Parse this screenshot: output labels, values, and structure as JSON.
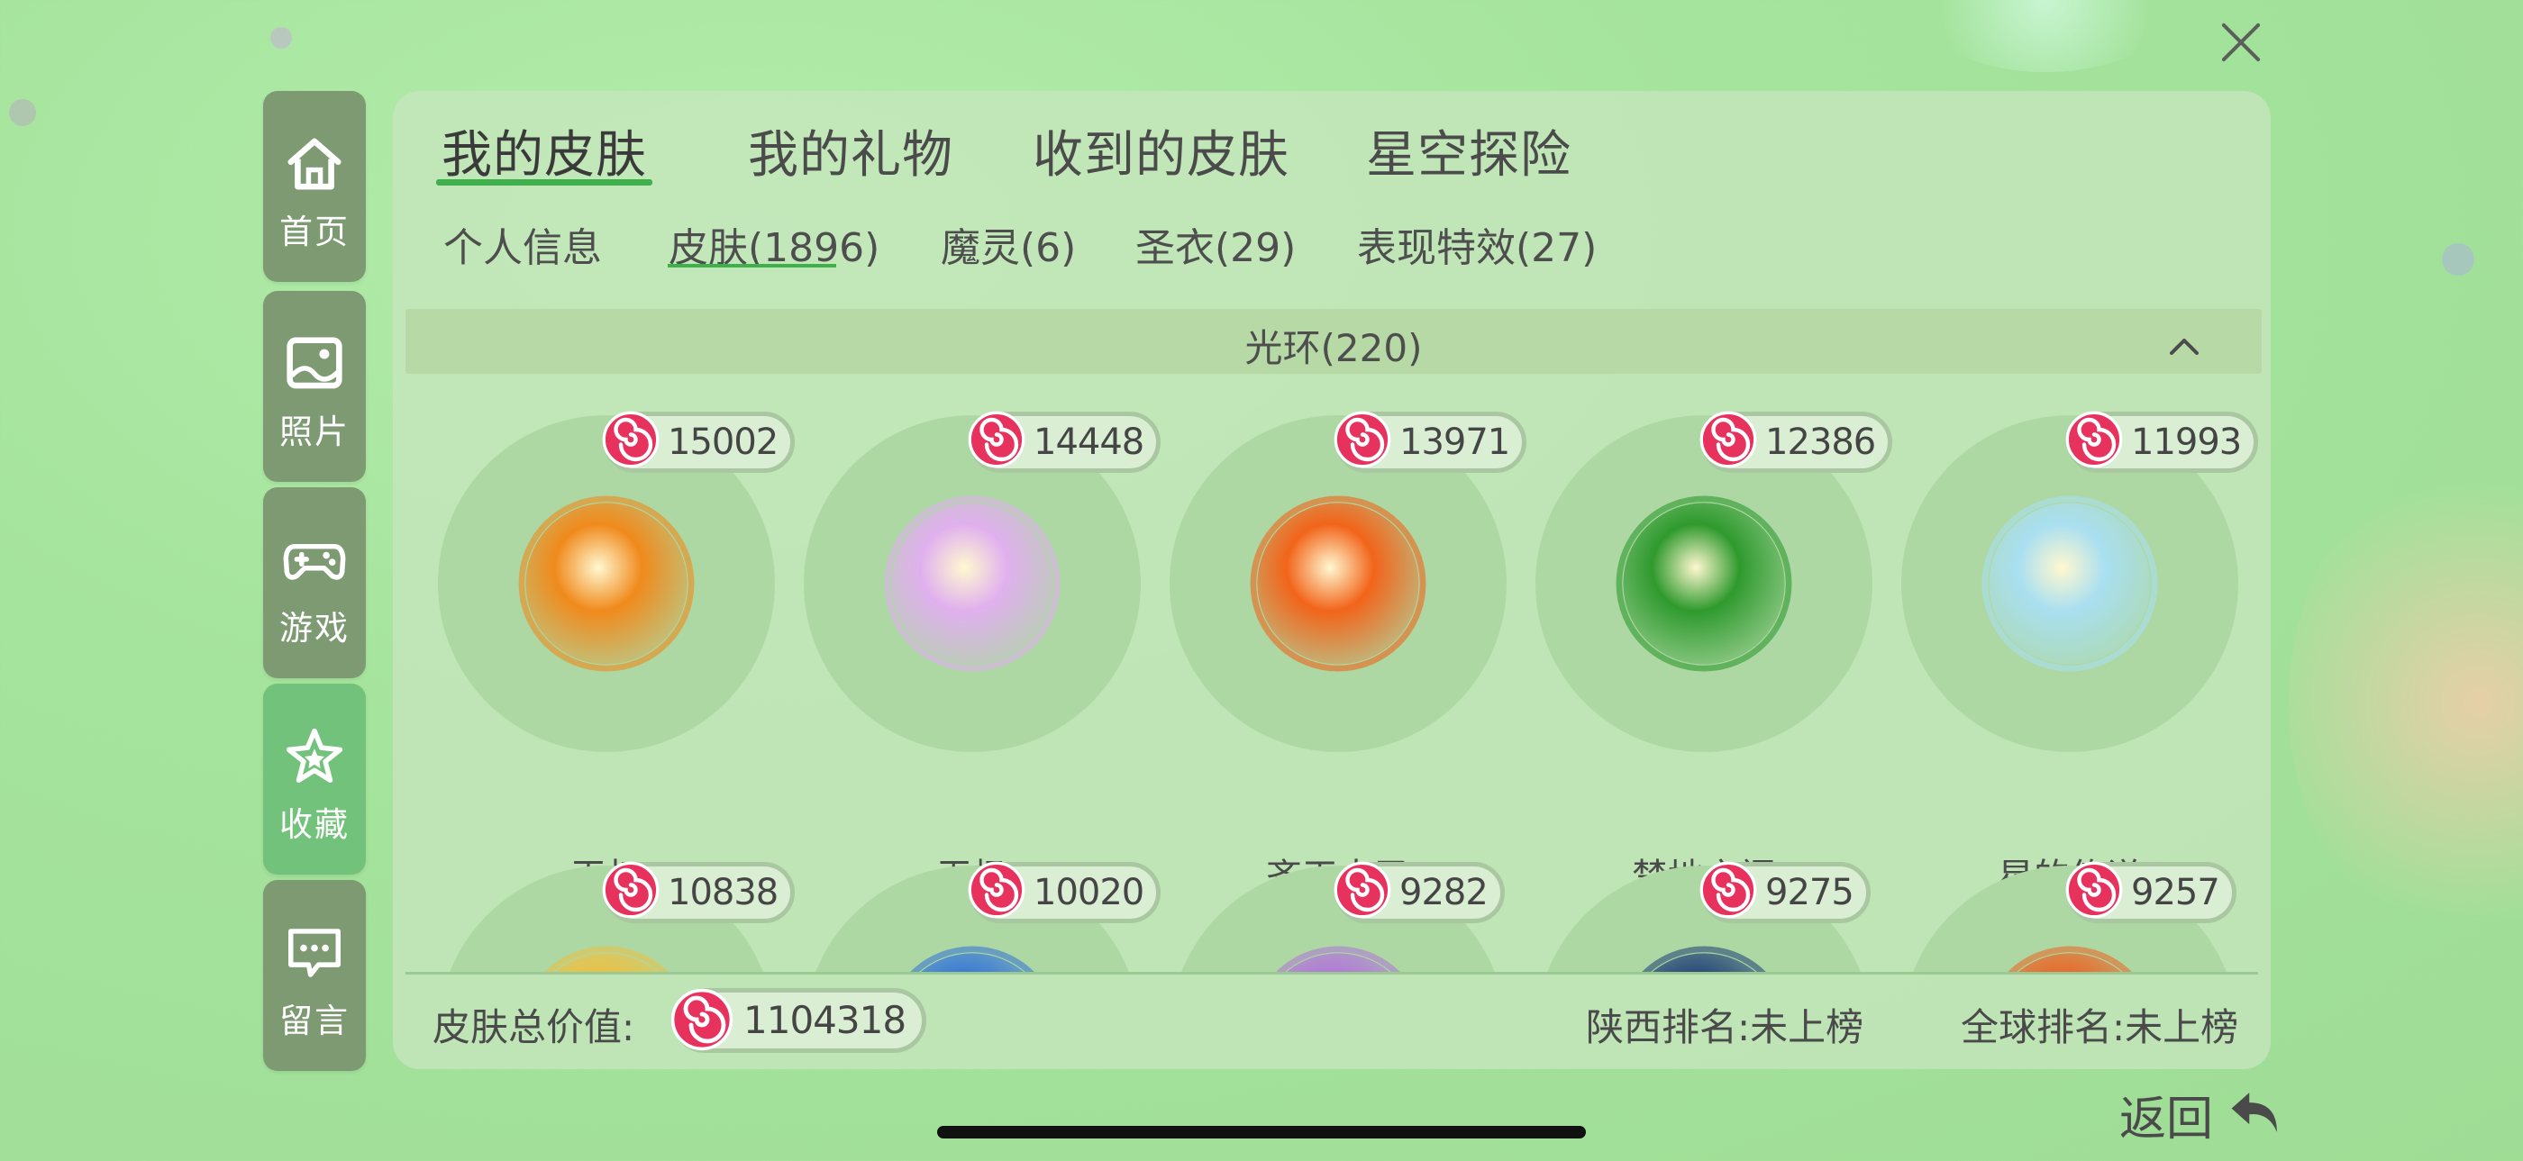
{
  "nav": [
    {
      "label": "首页",
      "icon": "home-icon",
      "active": false
    },
    {
      "label": "照片",
      "icon": "photo-icon",
      "active": false
    },
    {
      "label": "游戏",
      "icon": "gamepad-icon",
      "active": false
    },
    {
      "label": "收藏",
      "icon": "star-icon",
      "active": true
    },
    {
      "label": "留言",
      "icon": "message-icon",
      "active": false
    }
  ],
  "tabs": [
    "我的皮肤",
    "我的礼物",
    "收到的皮肤",
    "星空探险"
  ],
  "active_tab": "我的皮肤",
  "subtabs": [
    "个人信息",
    "皮肤(1896)",
    "魔灵(6)",
    "圣衣(29)",
    "表现特效(27)"
  ],
  "active_subtab": "皮肤(1896)",
  "section": {
    "title": "光环(220)"
  },
  "items": [
    {
      "name": "王权",
      "value": "15002",
      "color": "#f08a1c"
    },
    {
      "name": "无极",
      "value": "14448",
      "color": "#e0b0ee"
    },
    {
      "name": "齐天大圣",
      "value": "13971",
      "color": "#f2641a"
    },
    {
      "name": "禁地之门",
      "value": "12386",
      "color": "#2f9a2e"
    },
    {
      "name": "星的传说",
      "value": "11993",
      "color": "#a9dff0"
    },
    {
      "name": "",
      "value": "10838",
      "color": "#e8c24a"
    },
    {
      "name": "",
      "value": "10020",
      "color": "#3b7ad6"
    },
    {
      "name": "",
      "value": "9282",
      "color": "#b07ad6"
    },
    {
      "name": "",
      "value": "9275",
      "color": "#2a4a7a"
    },
    {
      "name": "",
      "value": "9257",
      "color": "#e86a2a"
    }
  ],
  "footer": {
    "total_label": "皮肤总价值:",
    "total_value": "1104318",
    "rank_local": "陕西排名:未上榜",
    "rank_global": "全球排名:未上榜"
  },
  "back_label": "返回",
  "colors": {
    "accent": "#3fb04b",
    "nav_bg": "#7d9a73",
    "nav_active": "#73c27b"
  }
}
